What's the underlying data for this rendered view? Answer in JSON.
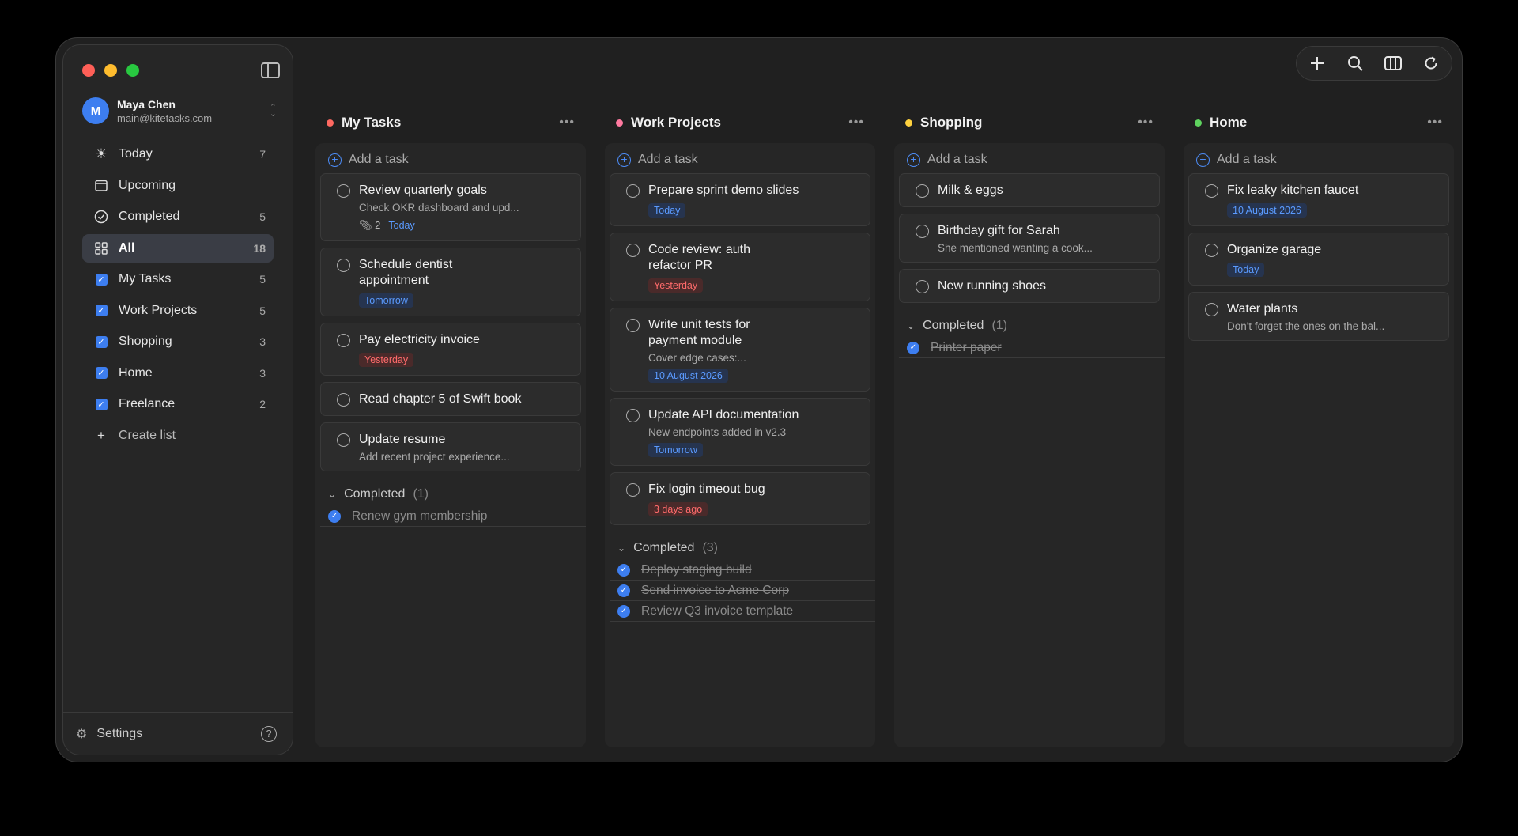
{
  "account": {
    "initial": "M",
    "name": "Maya Chen",
    "email": "main@kitetasks.com"
  },
  "nav": [
    {
      "label": "Today",
      "count": "7",
      "icon": "sun-icon"
    },
    {
      "label": "Upcoming",
      "count": "",
      "icon": "calendar-icon"
    },
    {
      "label": "Completed",
      "count": "5",
      "icon": "check-circle-icon"
    },
    {
      "label": "All",
      "count": "18",
      "icon": "grid-icon"
    },
    {
      "label": "My Tasks",
      "count": "5",
      "icon": "checkbox-icon"
    },
    {
      "label": "Work Projects",
      "count": "5",
      "icon": "checkbox-icon"
    },
    {
      "label": "Shopping",
      "count": "3",
      "icon": "checkbox-icon"
    },
    {
      "label": "Home",
      "count": "3",
      "icon": "checkbox-icon"
    },
    {
      "label": "Freelance",
      "count": "2",
      "icon": "checkbox-icon"
    },
    {
      "label": "Create list",
      "count": "",
      "icon": "plus-icon"
    }
  ],
  "footer": {
    "settings": "Settings"
  },
  "add_task_label": "Add a task",
  "completed_label": "Completed",
  "colors": {
    "accent": "#3d7ef0",
    "red_dot": "#ff6961",
    "pink_dot": "#ff7aa0",
    "yellow_dot": "#ffd23f",
    "green_dot": "#5fd35f"
  },
  "columns": [
    {
      "title": "My Tasks",
      "tasks": [
        {
          "title": "Review quarterly goals",
          "note": "Check OKR dashboard and upd...",
          "attachments": "2",
          "badge": "Today",
          "badge_style": "blue plain"
        },
        {
          "title": "Schedule dentist appointment",
          "note": "",
          "badge": "Tomorrow",
          "badge_style": "blue plain"
        },
        {
          "title": "Pay electricity invoice",
          "note": "",
          "badge": "Yesterday",
          "badge_style": "red"
        },
        {
          "title": "Read chapter 5 of Swift book",
          "note": "",
          "badge": ""
        },
        {
          "title": "Update resume",
          "note": "Add recent project experience...",
          "badge": ""
        }
      ],
      "completed_count": "(1)",
      "completed": [
        "Renew gym membership"
      ]
    },
    {
      "title": "Work Projects",
      "tasks": [
        {
          "title": "Prepare sprint demo slides",
          "note": "",
          "badge": "Today",
          "badge_style": "blue"
        },
        {
          "title": "Code review: auth refactor PR",
          "note": "",
          "badge": "Yesterday",
          "badge_style": "red"
        },
        {
          "title": "Write unit tests for payment module",
          "note": "Cover edge cases:...",
          "badge": "10 August 2026",
          "badge_style": "blue"
        },
        {
          "title": "Update API documentation",
          "note": "New endpoints added in v2.3",
          "badge": "Tomorrow",
          "badge_style": "blue"
        },
        {
          "title": "Fix login timeout bug",
          "note": "",
          "badge": "3 days ago",
          "badge_style": "red"
        }
      ],
      "completed_count": "(3)",
      "completed": [
        "Deploy staging build",
        "Send invoice to Acme Corp",
        "Review Q3 invoice template"
      ]
    },
    {
      "title": "Shopping",
      "tasks": [
        {
          "title": "Milk & eggs",
          "note": "",
          "badge": ""
        },
        {
          "title": "Birthday gift for Sarah",
          "note": "She mentioned wanting a cook...",
          "badge": ""
        },
        {
          "title": "New running shoes",
          "note": "",
          "badge": ""
        }
      ],
      "completed_count": "(1)",
      "completed": [
        "Printer paper"
      ]
    },
    {
      "title": "Home",
      "tasks": [
        {
          "title": "Fix leaky kitchen faucet",
          "note": "",
          "badge": "10 August 2026",
          "badge_style": "blue"
        },
        {
          "title": "Organize garage",
          "note": "",
          "badge": "Today",
          "badge_style": "blue"
        },
        {
          "title": "Water plants",
          "note": "Don't forget the ones on the bal...",
          "badge": ""
        }
      ],
      "completed_count": "",
      "completed": []
    }
  ]
}
